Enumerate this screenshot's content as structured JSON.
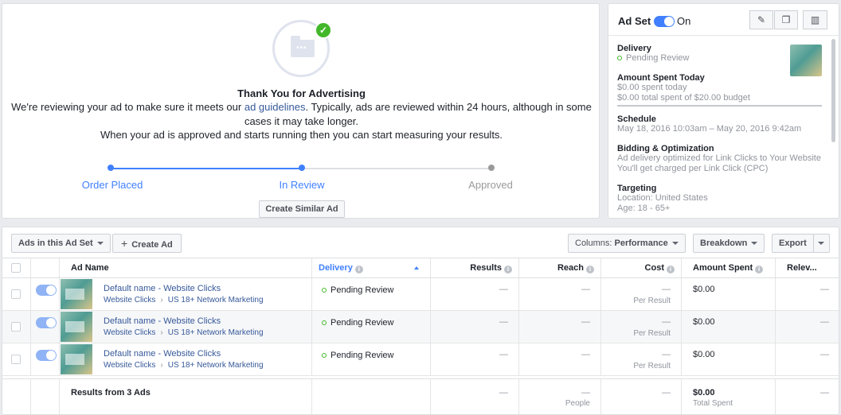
{
  "confirmation": {
    "title": "Thank You for Advertising",
    "message_before_link": "We're reviewing your ad to make sure it meets our ",
    "link_text": "ad guidelines",
    "message_after_link": ". Typically, ads are reviewed within 24 hours, although in some cases it may take longer.",
    "message2": "When your ad is approved and starts running then you can start measuring your results.",
    "steps": [
      {
        "label": "Order Placed",
        "state": "done"
      },
      {
        "label": "In Review",
        "state": "current"
      },
      {
        "label": "Approved",
        "state": "pending"
      }
    ],
    "progress_percent": 50,
    "create_similar_label": "Create Similar Ad",
    "icon": "folder-icon",
    "check_icon": "checkmark-icon"
  },
  "adset": {
    "label": "Ad Set",
    "toggle_state": "On",
    "actions": [
      {
        "name": "edit",
        "icon": "✎"
      },
      {
        "name": "duplicate",
        "icon": "❐"
      },
      {
        "name": "delete",
        "icon": "🗑"
      }
    ],
    "delivery_heading": "Delivery",
    "delivery_status": "Pending Review",
    "spent_heading": "Amount Spent Today",
    "spent_today": "$0.00 spent today",
    "spent_total": "$0.00 total spent of $20.00 budget",
    "schedule_heading": "Schedule",
    "schedule_value": "May 18, 2016 10:03am – May 20, 2016 9:42am",
    "bidding_heading": "Bidding & Optimization",
    "bidding_line1": "Ad delivery optimized for Link Clicks to Your Website",
    "bidding_line2": "You'll get charged per Link Click (CPC)",
    "targeting_heading": "Targeting",
    "targeting_location": "Location: United States",
    "targeting_age": "Age: 18 - 65+"
  },
  "toolbar": {
    "ads_in_set": "Ads in this Ad Set",
    "create_ad": "Create Ad",
    "columns_prefix": "Columns: ",
    "columns_value": "Performance",
    "breakdown": "Breakdown",
    "export": "Export"
  },
  "table": {
    "headers": {
      "ad_name": "Ad Name",
      "delivery": "Delivery",
      "results": "Results",
      "reach": "Reach",
      "cost": "Cost",
      "amount_spent": "Amount Spent",
      "relevance": "Relev..."
    },
    "rows": [
      {
        "name": "Default name - Website Clicks",
        "objective": "Website Clicks",
        "adset": "US 18+ Network Marketing",
        "delivery": "Pending Review",
        "results": "—",
        "reach": "—",
        "cost": "—",
        "cost_sub": "Per Result",
        "spent": "$0.00",
        "relevance": "—"
      },
      {
        "name": "Default name - Website Clicks",
        "objective": "Website Clicks",
        "adset": "US 18+ Network Marketing",
        "delivery": "Pending Review",
        "results": "—",
        "reach": "—",
        "cost": "—",
        "cost_sub": "Per Result",
        "spent": "$0.00",
        "relevance": "—"
      },
      {
        "name": "Default name - Website Clicks",
        "objective": "Website Clicks",
        "adset": "US 18+ Network Marketing",
        "delivery": "Pending Review",
        "results": "—",
        "reach": "—",
        "cost": "—",
        "cost_sub": "Per Result",
        "spent": "$0.00",
        "relevance": "—"
      }
    ],
    "totals": {
      "label": "Results from 3 Ads",
      "results": "—",
      "reach": "—",
      "reach_sub": "People",
      "cost": "—",
      "spent": "$0.00",
      "spent_sub": "Total Spent",
      "relevance": "—"
    }
  },
  "colors": {
    "accent": "#4080ff",
    "link": "#365899",
    "status_green": "#42b72a"
  }
}
